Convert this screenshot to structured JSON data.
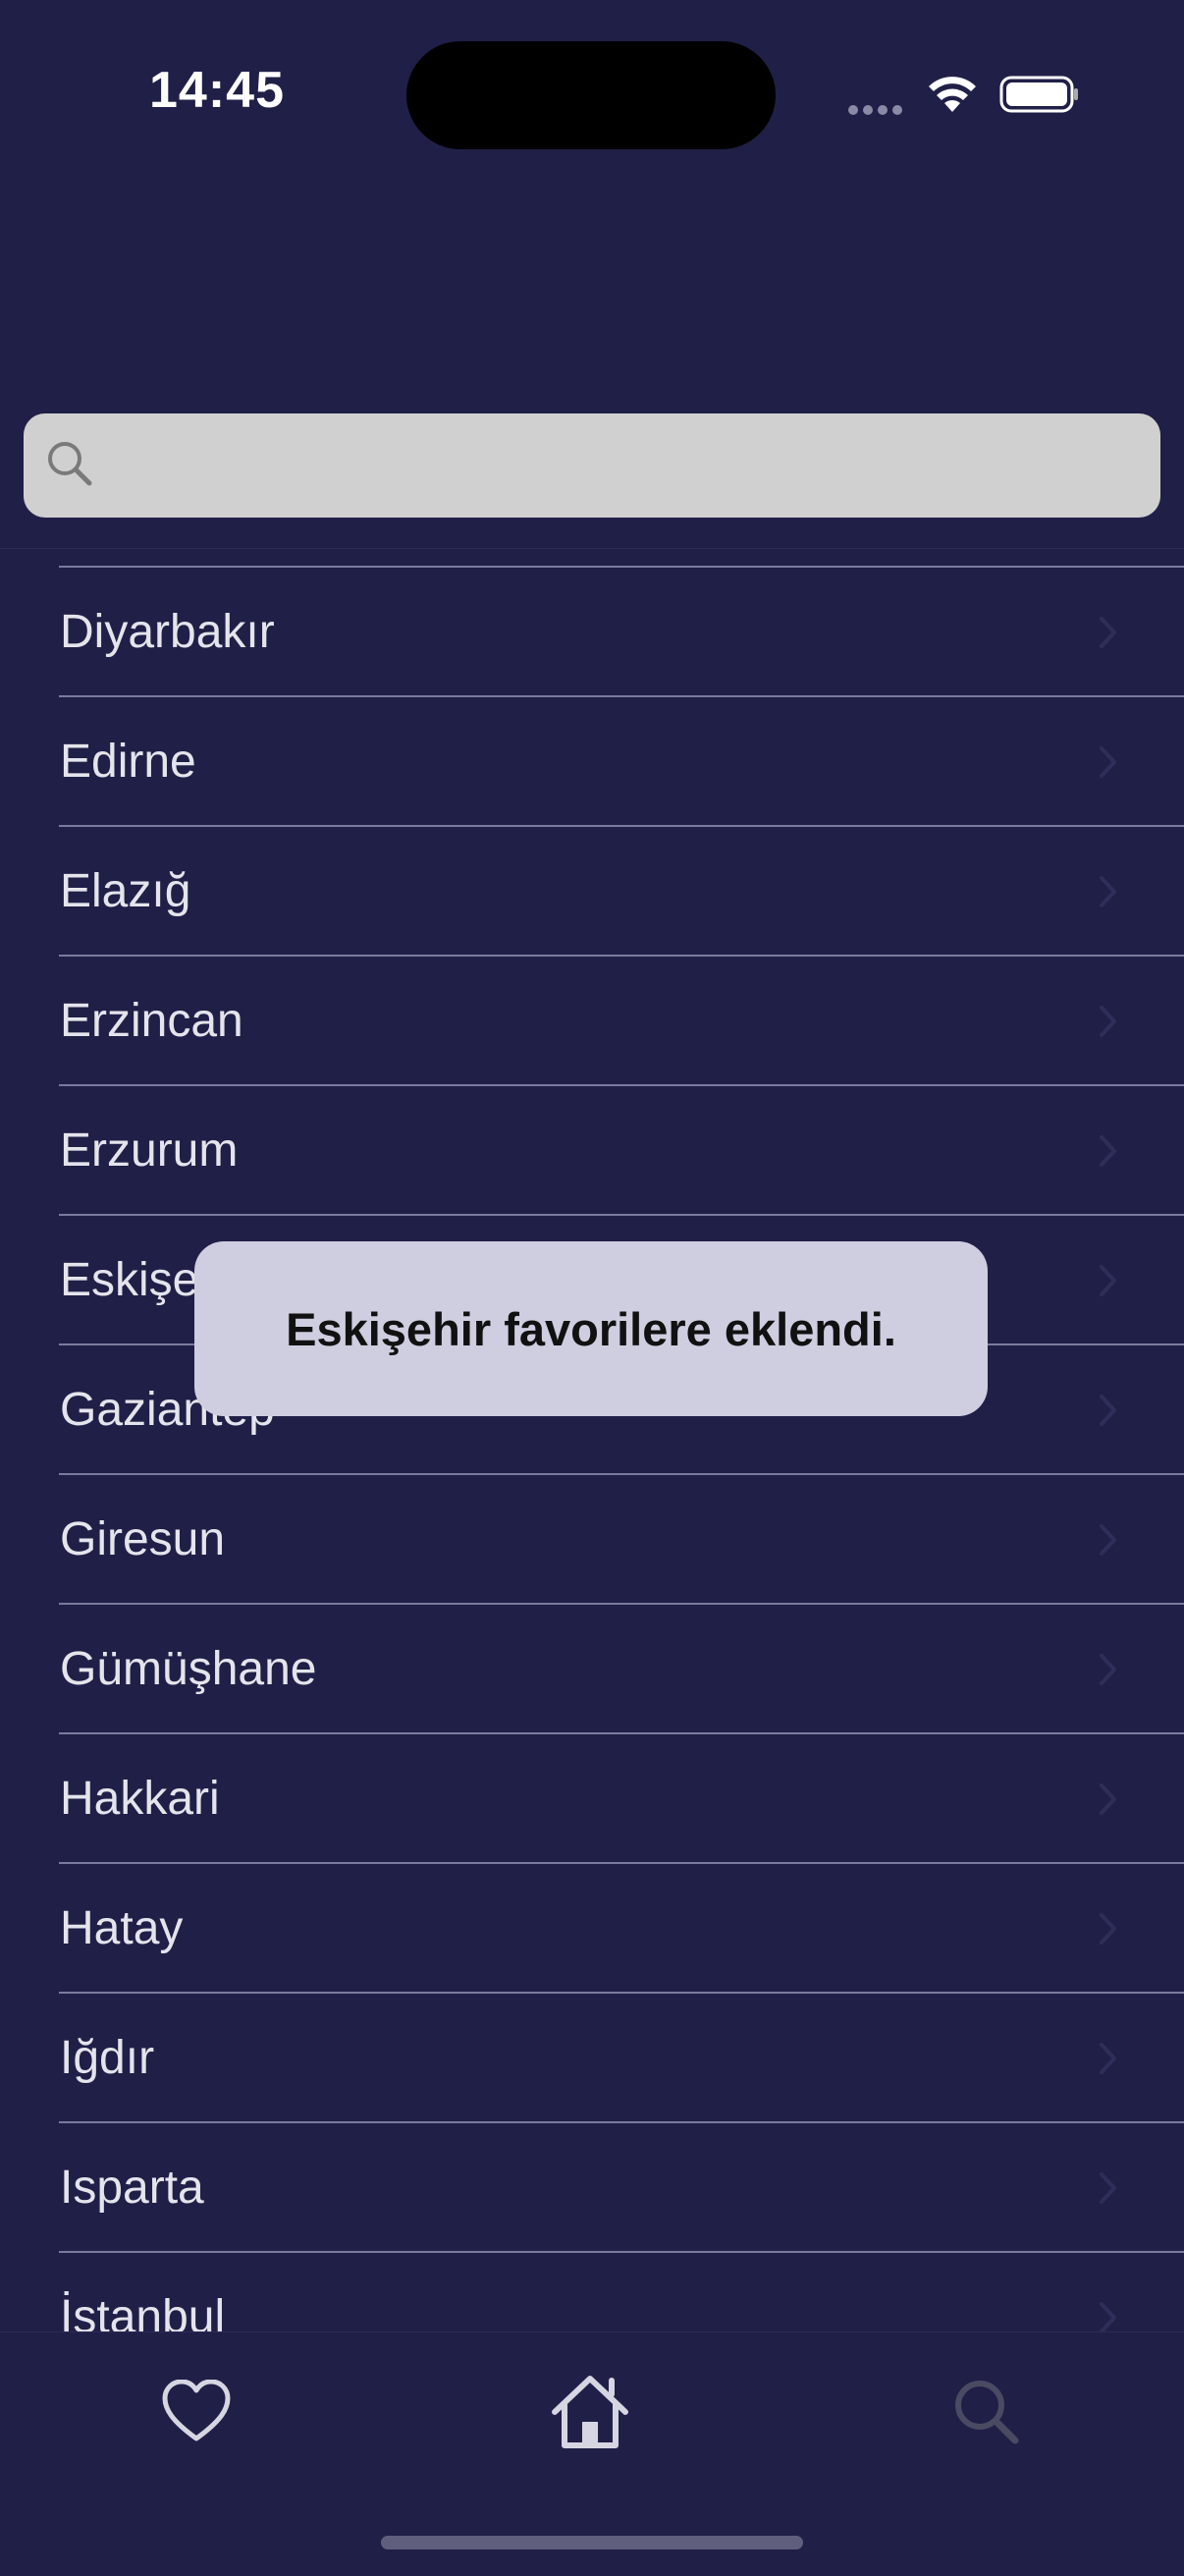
{
  "status_bar": {
    "time": "14:45"
  },
  "search": {
    "placeholder": "",
    "value": ""
  },
  "cities": [
    "Diyarbakır",
    "Edirne",
    "Elazığ",
    "Erzincan",
    "Erzurum",
    "Eskişehir",
    "Gaziantep",
    "Giresun",
    "Gümüşhane",
    "Hakkari",
    "Hatay",
    "Iğdır",
    "Isparta",
    "İstanbul"
  ],
  "toast": {
    "message": "Eskişehir favorilere eklendi."
  },
  "tab_bar": {
    "items": [
      {
        "icon": "heart-icon"
      },
      {
        "icon": "home-icon"
      },
      {
        "icon": "search-icon"
      }
    ]
  },
  "colors": {
    "background": "#201f47",
    "search_field": "#d0d0d0",
    "divider": "#7b7a9e",
    "toast_background": "#cfcde0"
  }
}
